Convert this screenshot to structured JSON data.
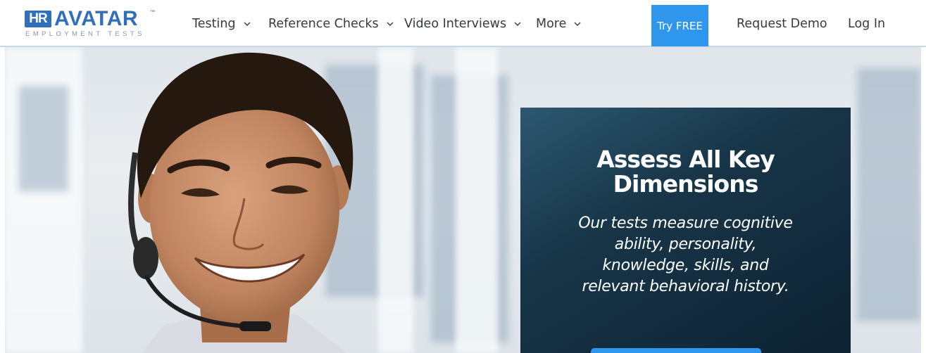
{
  "logo": {
    "badge": "HR",
    "name": "AVATAR",
    "tm": "™",
    "tagline": "EMPLOYMENT TESTS"
  },
  "nav": {
    "items": [
      {
        "label": "Testing"
      },
      {
        "label": "Reference Checks"
      },
      {
        "label": "Video Interviews"
      },
      {
        "label": "More"
      }
    ],
    "try_free": "Try FREE",
    "request_demo": "Request Demo",
    "log_in": "Log In"
  },
  "hero": {
    "title": "Assess All Key Dimensions",
    "title_lines": [
      "Assess All Key",
      "Dimensions"
    ],
    "description_lines": [
      "Our tests measure cognitive",
      "ability, personality,",
      "knowledge, skills, and",
      "relevant behavioral history."
    ]
  },
  "colors": {
    "brand": "#2f6fbc",
    "accent": "#2f96ee",
    "panel": "#183649"
  },
  "icons": {
    "dropdown": "chevron-down-icon"
  }
}
